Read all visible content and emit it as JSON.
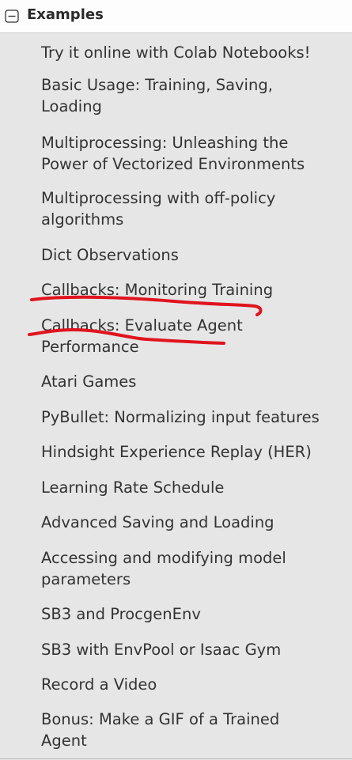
{
  "section": {
    "title": "Examples",
    "toggle_icon": "minus-square-icon"
  },
  "items": [
    {
      "lines": [
        "Try it online with Colab Notebooks!"
      ]
    },
    {
      "lines": [
        "Basic Usage: Training, Saving,",
        "Loading"
      ]
    },
    {
      "lines": [
        "Multiprocessing: Unleashing the",
        "Power of Vectorized Environments"
      ]
    },
    {
      "lines": [
        "Multiprocessing with off-policy",
        "algorithms"
      ]
    },
    {
      "lines": [
        "Dict Observations"
      ]
    },
    {
      "lines": [
        "Callbacks: Monitoring Training"
      ]
    },
    {
      "lines": [
        "Callbacks: Evaluate Agent",
        "Performance"
      ]
    },
    {
      "lines": [
        "Atari Games"
      ]
    },
    {
      "lines": [
        "PyBullet: Normalizing input features"
      ]
    },
    {
      "lines": [
        "Hindsight Experience Replay (HER)"
      ]
    },
    {
      "lines": [
        "Learning Rate Schedule"
      ]
    },
    {
      "lines": [
        "Advanced Saving and Loading"
      ]
    },
    {
      "lines": [
        "Accessing and modifying model",
        "parameters"
      ]
    },
    {
      "lines": [
        "SB3 and ProcgenEnv"
      ]
    },
    {
      "lines": [
        "SB3 with EnvPool or Isaac Gym"
      ]
    },
    {
      "lines": [
        "Record a Video"
      ]
    },
    {
      "lines": [
        "Bonus: Make a GIF of a Trained",
        "Agent"
      ]
    }
  ],
  "annotation_color": "#e0141e"
}
